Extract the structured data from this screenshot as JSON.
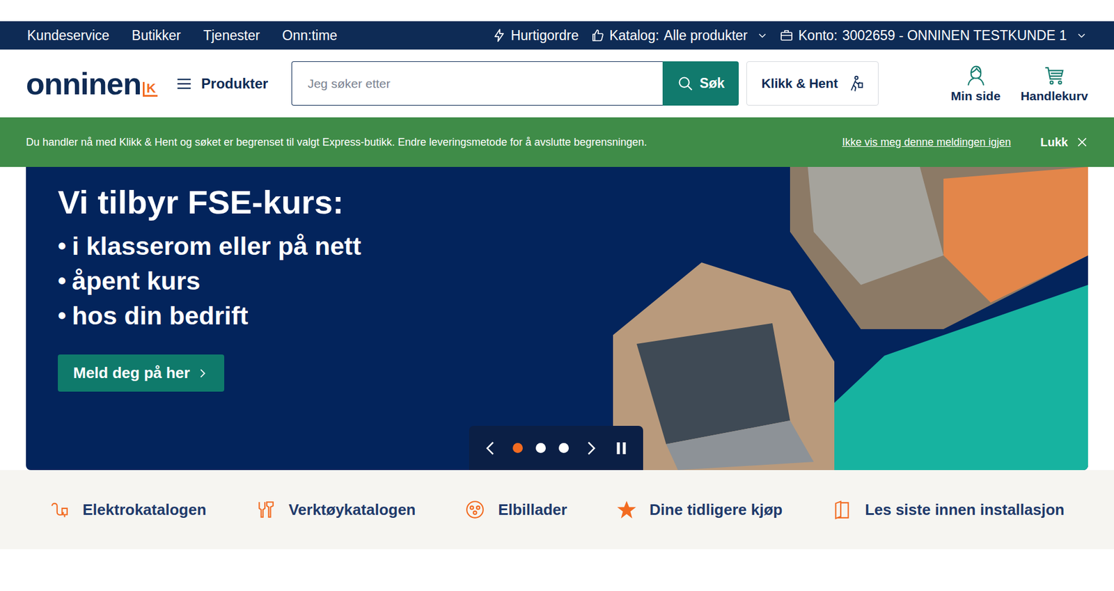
{
  "top_bar": {
    "links": [
      "Kundeservice",
      "Butikker",
      "Tjenester",
      "Onn:time"
    ],
    "quick_order": "Hurtigordre",
    "catalog_label": "Katalog:",
    "catalog_value": "Alle produkter",
    "account_label": "Konto:",
    "account_value": "3002659 - ONNINEN TESTKUNDE 1"
  },
  "header": {
    "logo": "onninen",
    "logo_badge": "K",
    "menu": "Produkter",
    "search": {
      "placeholder": "Jeg søker etter",
      "button": "Søk"
    },
    "click_collect": "Klikk & Hent",
    "my_page": "Min side",
    "cart": "Handlekurv"
  },
  "notice": {
    "text": "Du handler nå med Klikk & Hent og søket er begrenset til valgt Express-butikk. Endre leveringsmetode for å avslutte begrensningen.",
    "hide_link": "Ikke vis meg denne meldingen igjen",
    "close": "Lukk"
  },
  "hero": {
    "title": "Vi tilbyr FSE-kurs:",
    "bullet": "•",
    "bullets": [
      "i klasserom eller på nett",
      "åpent kurs",
      "hos din bedrift"
    ],
    "button": "Meld deg på her",
    "slides": [
      {
        "selected": true
      },
      {
        "selected": false
      },
      {
        "selected": false
      }
    ]
  },
  "categories": [
    {
      "label": "Elektrokatalogen",
      "kind": "cable"
    },
    {
      "label": "Verktøykatalogen",
      "kind": "tools"
    },
    {
      "label": "Elbillader",
      "kind": "charger"
    },
    {
      "label": "Dine tidligere kjøp",
      "kind": "star"
    },
    {
      "label": "Les siste innen installasjon",
      "kind": "book"
    }
  ]
}
